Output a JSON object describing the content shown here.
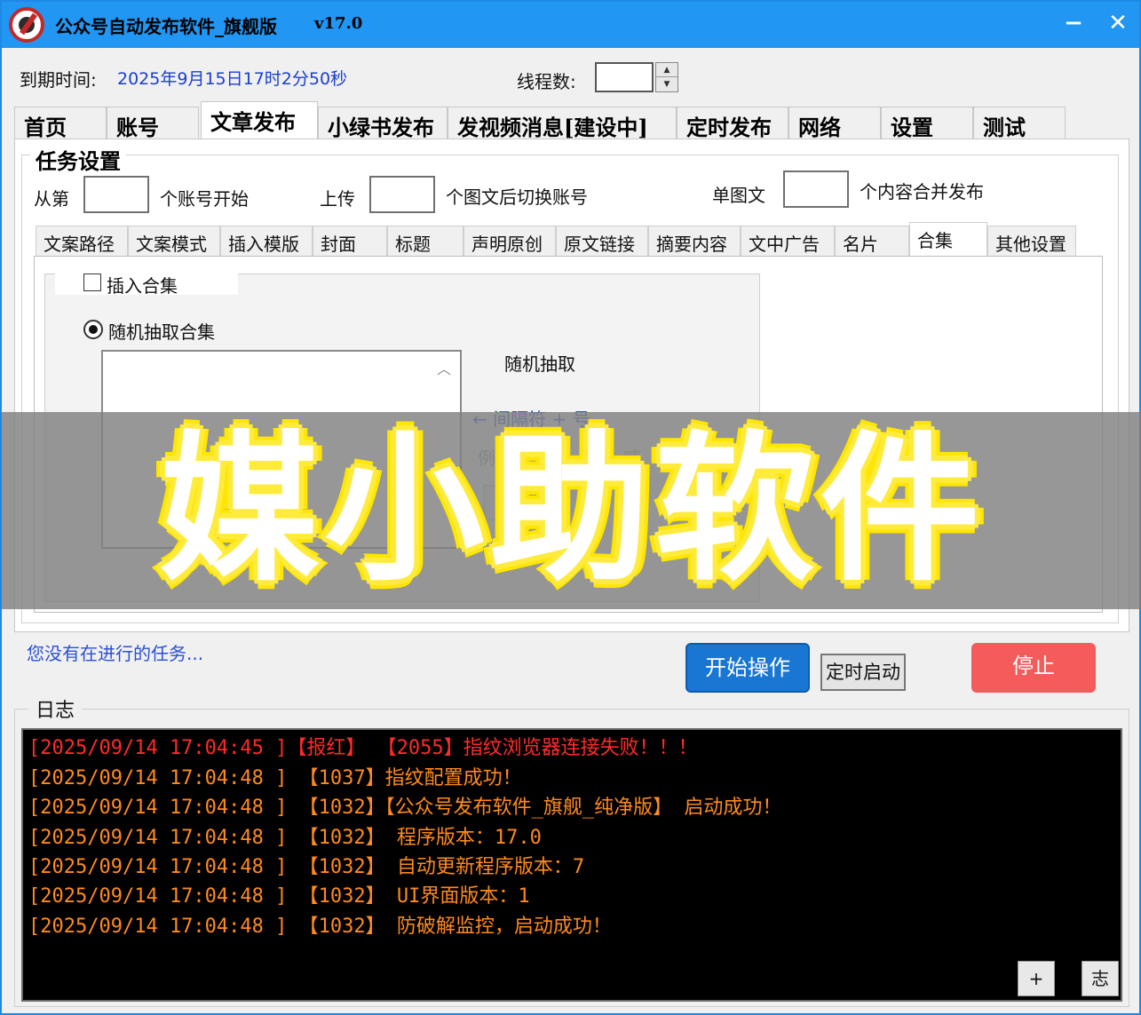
{
  "window": {
    "title": "公众号自动发布软件_旗舰版",
    "version": "v17.0",
    "minimize_label": "−",
    "close_label": "✕"
  },
  "header": {
    "expire_label": "到期时间:",
    "expire_value": "2025年9月15日17时2分50秒",
    "threads_label": "线程数:",
    "threads_value": ""
  },
  "main_tabs": [
    {
      "label": "首页"
    },
    {
      "label": "账号"
    },
    {
      "label": "文章发布",
      "active": true
    },
    {
      "label": "小绿书发布"
    },
    {
      "label": "发视频消息[建设中]"
    },
    {
      "label": "定时发布"
    },
    {
      "label": "网络"
    },
    {
      "label": "设置"
    },
    {
      "label": "测试"
    }
  ],
  "task_settings": {
    "title": "任务设置",
    "from_label": "从第",
    "from_suffix": "个账号开始",
    "upload_label": "上传",
    "upload_suffix": "个图文后切换账号",
    "single_label": "单图文",
    "single_suffix": "个内容合并发布"
  },
  "sub_tabs": [
    {
      "label": "文案路径"
    },
    {
      "label": "文案模式"
    },
    {
      "label": "插入模版"
    },
    {
      "label": "封面"
    },
    {
      "label": "标题"
    },
    {
      "label": "声明原创"
    },
    {
      "label": "原文链接"
    },
    {
      "label": "摘要内容"
    },
    {
      "label": "文中广告"
    },
    {
      "label": "名片"
    },
    {
      "label": "合集",
      "active": true
    },
    {
      "label": "其他设置"
    }
  ],
  "collection": {
    "insert_label": "插入合集",
    "insert_checked": false,
    "random_label": "随机抽取合集",
    "random_selected": true,
    "random_note": "随机抽取",
    "separator_hint": "← 间隔符 + 号",
    "example_prefix": "例",
    "example_suffix": "嘻"
  },
  "overlay": {
    "text": "媒小助软件"
  },
  "status": {
    "text": "您没有在进行的任务..."
  },
  "buttons": {
    "start": "开始操作",
    "timer": "定时启动",
    "stop": "停止"
  },
  "log": {
    "title": "日志",
    "lines": [
      {
        "text": "[2025/09/14 17:04:45 ]【报红】 【2055】指纹浏览器连接失败！！！",
        "level": "error"
      },
      {
        "text": "[2025/09/14 17:04:48 ] 【1037】指纹配置成功！",
        "level": "info"
      },
      {
        "text": "[2025/09/14 17:04:48 ] 【1032】【公众号发布软件_旗舰_纯净版】 启动成功！",
        "level": "info"
      },
      {
        "text": "[2025/09/14 17:04:48 ] 【1032】 程序版本：17.0",
        "level": "info"
      },
      {
        "text": "[2025/09/14 17:04:48 ] 【1032】 自动更新程序版本：7",
        "level": "info"
      },
      {
        "text": "[2025/09/14 17:04:48 ] 【1032】 UI界面版本：1",
        "level": "info"
      },
      {
        "text": "[2025/09/14 17:04:48 ] 【1032】 防破解监控，启动成功！",
        "level": "info"
      }
    ],
    "plus_label": "+",
    "log_button_label": "志"
  }
}
